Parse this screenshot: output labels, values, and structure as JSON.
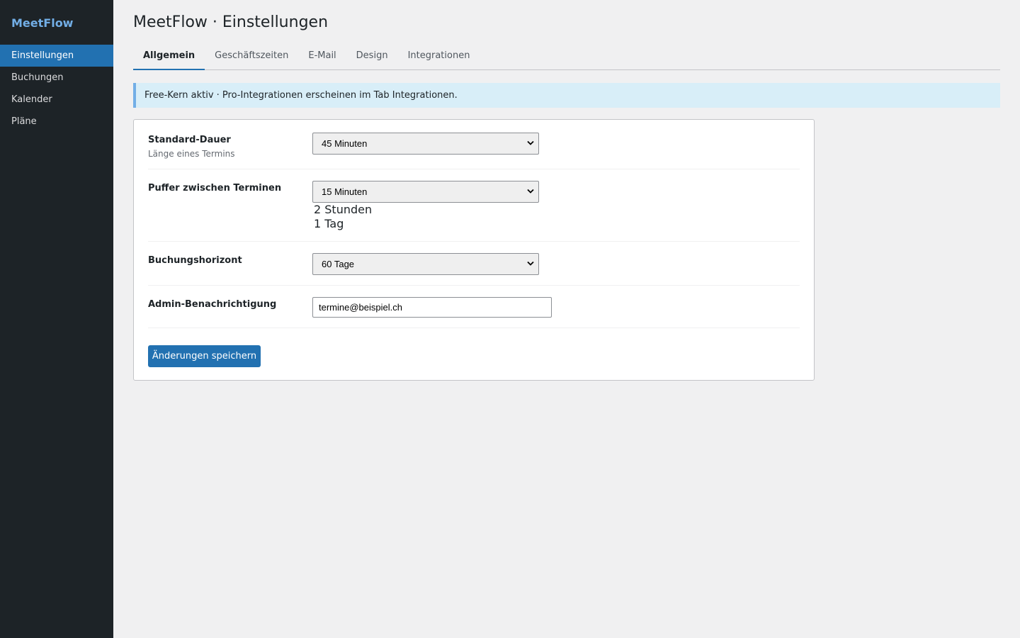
{
  "app": {
    "brand": "MeetFlow",
    "page_title": "MeetFlow · Einstellungen"
  },
  "sidebar": {
    "items": [
      {
        "label": "Einstellungen",
        "active": true
      },
      {
        "label": "Buchungen"
      },
      {
        "label": "Kalender"
      },
      {
        "label": "Pläne"
      }
    ]
  },
  "tabs": [
    {
      "label": "Allgemein",
      "active": true
    },
    {
      "label": "Geschäftszeiten"
    },
    {
      "label": "E-Mail"
    },
    {
      "label": "Design"
    },
    {
      "label": "Integrationen"
    }
  ],
  "notice": "Free-Kern aktiv · Pro-Integrationen erscheinen im Tab Integrationen.",
  "settings": {
    "duration": {
      "label": "Standard-Dauer",
      "description": "Länge eines Termins",
      "value": "45 Minuten"
    },
    "buffer": {
      "label": "Puffer zwischen Terminen",
      "value": "15 Minuten",
      "overflow_options": [
        "2 Stunden",
        "1 Tag"
      ]
    },
    "horizon": {
      "label": "Buchungshorizont",
      "value": "60 Tage"
    },
    "notification": {
      "label": "Admin-Benachrichtigung",
      "value": "termine@beispiel.ch"
    }
  },
  "save_button": "Änderungen speichern",
  "colors": {
    "accent": "#2271b1",
    "sidebar_bg": "#1d2327",
    "notice_bg": "#d8eef8"
  }
}
